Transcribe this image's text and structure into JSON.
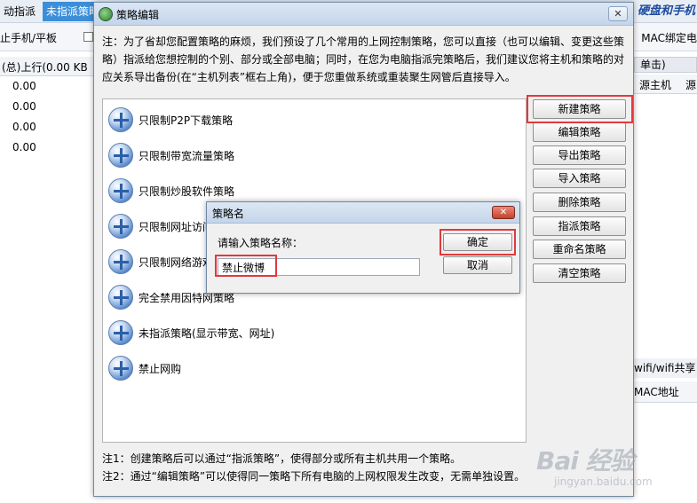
{
  "background": {
    "tabs": [
      "动指派",
      "未指派策略"
    ],
    "title_right": "硬盘和手机",
    "toolbar_left": "止手机/平板",
    "toolbar_right": "MAC绑定电",
    "grid_header": "(总)上行(0.00 KB",
    "grid_values": [
      "0.00",
      "0.00",
      "0.00",
      "0.00"
    ],
    "right_tab": "单击)",
    "right_cols": [
      "源主机",
      "源"
    ],
    "right_tab2": "wifi/wifi共享",
    "right_col2": "MAC地址"
  },
  "dialog": {
    "title": "策略编辑",
    "close_symbol": "✕",
    "note_line1": "注：为了省却您配置策略的麻烦，我们预设了几个常用的上网控制策略，您可以直接（也可以编辑、变更这些策",
    "note_line2": "略）指派给您想控制的个别、部分或全部电脑；同时，在您为电脑指派完策略后，我们建议您将主机和策略的对",
    "note_line3": "应关系导出备份(在“主机列表”框右上角)，便于您重做系统或重装聚生网管后直接导入。",
    "strategies": [
      "只限制P2P下载策略",
      "只限制带宽流量策略",
      "只限制炒股软件策略",
      "只限制网址访问策略",
      "只限制网络游戏策略",
      "完全禁用因特网策略",
      "未指派策略(显示带宽、网址)",
      "禁止网购"
    ],
    "buttons": {
      "new": "新建策略",
      "edit": "编辑策略",
      "export": "导出策略",
      "import": "导入策略",
      "delete": "删除策略",
      "assign": "指派策略",
      "rename": "重命名策略",
      "clear": "清空策略"
    },
    "footnote1": "注1：创建策略后可以通过“指派策略”，使得部分或所有主机共用一个策略。",
    "footnote2": "注2：通过“编辑策略”可以使得同一策略下所有电脑的上网权限发生改变，无需单独设置。"
  },
  "sub_dialog": {
    "title": "策略名",
    "close_symbol": "✕",
    "prompt": "请输入策略名称：",
    "input_value": "禁止微博",
    "ok": "确定",
    "cancel": "取消"
  },
  "watermark": {
    "logo": "Bai 经验",
    "url": "jingyan.baidu.com"
  },
  "colors": {
    "highlight_red": "#e0393e",
    "tab_blue": "#3b8fd9"
  }
}
